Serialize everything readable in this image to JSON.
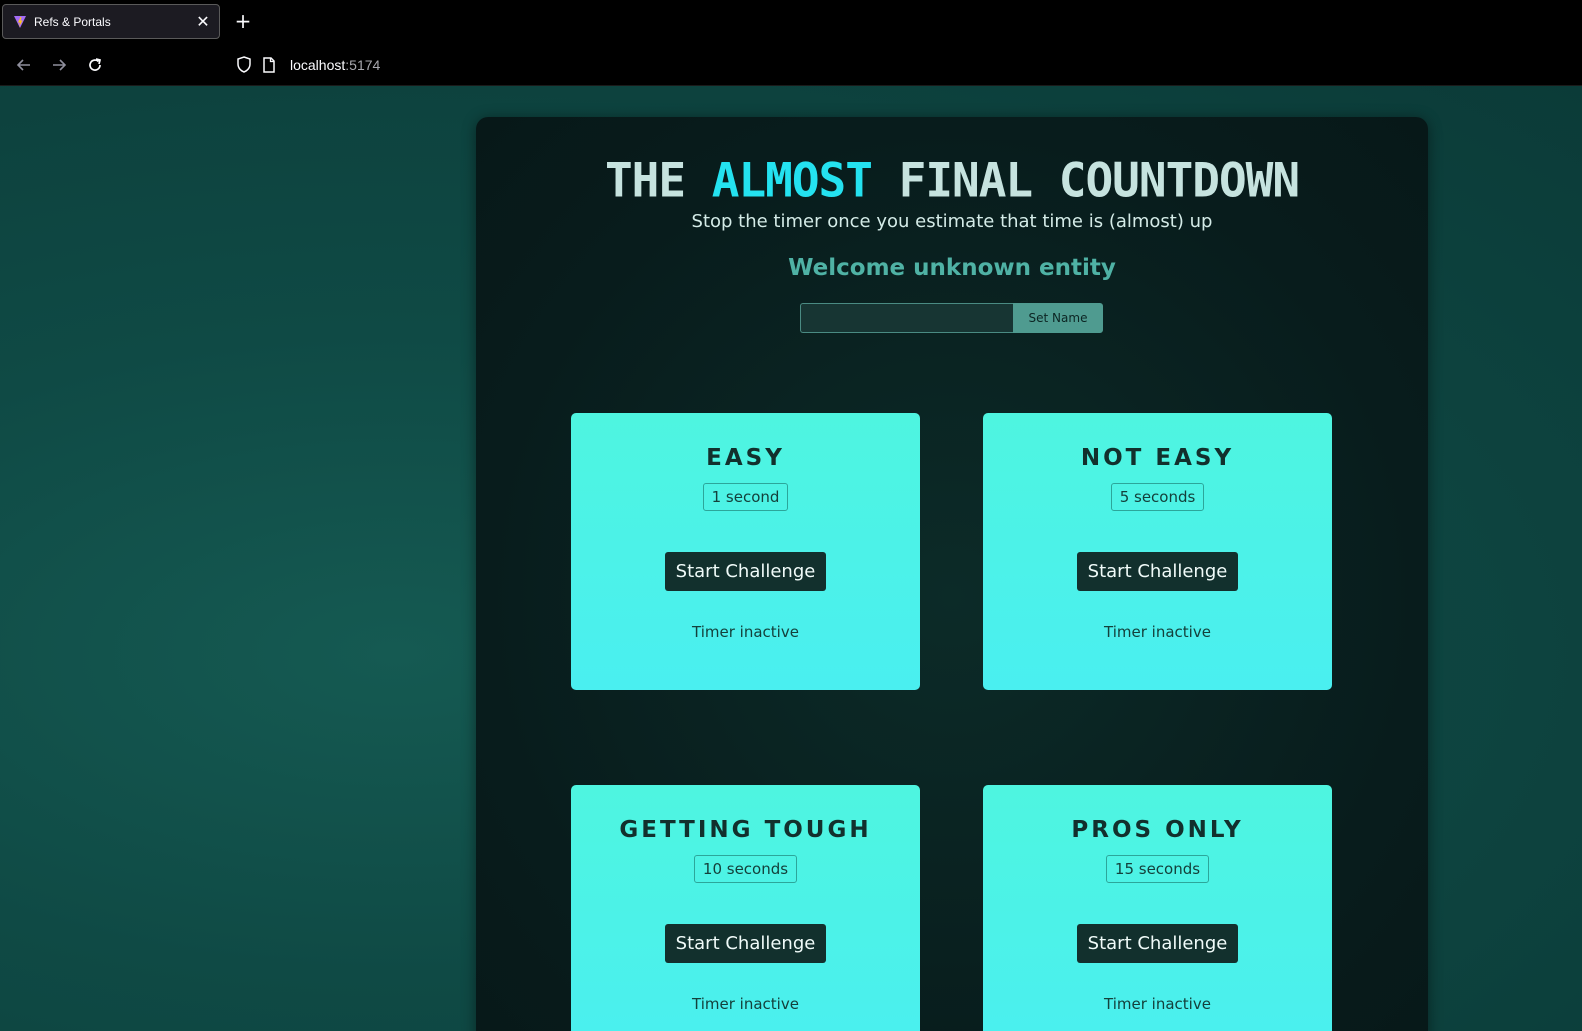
{
  "browser": {
    "tab_title": "Refs & Portals",
    "tab_close": "✕",
    "new_tab": "+",
    "url_host": "localhost",
    "url_port": ":5174"
  },
  "app": {
    "title_prefix": "THE",
    "title_accent": "ALMOST",
    "title_suffix": "FINAL COUNTDOWN",
    "subtitle": "Stop the timer once you estimate that time is (almost) up",
    "welcome": "Welcome unknown entity",
    "name_input_value": "",
    "set_name_label": "Set Name"
  },
  "challenges": [
    {
      "title": "EASY",
      "duration": "1 second",
      "button": "Start Challenge",
      "status": "Timer inactive"
    },
    {
      "title": "NOT EASY",
      "duration": "5 seconds",
      "button": "Start Challenge",
      "status": "Timer inactive"
    },
    {
      "title": "GETTING TOUGH",
      "duration": "10 seconds",
      "button": "Start Challenge",
      "status": "Timer inactive"
    },
    {
      "title": "PROS ONLY",
      "duration": "15 seconds",
      "button": "Start Challenge",
      "status": "Timer inactive"
    }
  ],
  "colors": {
    "accent": "#24e2f0",
    "card": "#4ef5e0",
    "button": "#12302d"
  }
}
